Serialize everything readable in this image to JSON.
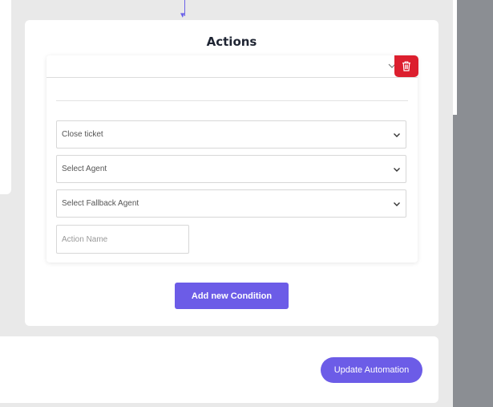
{
  "actions": {
    "title": "Actions",
    "fields": {
      "action_type": {
        "value": "Close ticket"
      },
      "agent": {
        "placeholder": "Select Agent"
      },
      "fallback_agent": {
        "placeholder": "Select Fallback Agent"
      },
      "action_name": {
        "placeholder": "Action Name"
      }
    },
    "add_condition_label": "Add new Condition"
  },
  "footer": {
    "update_label": "Update Automation"
  },
  "icons": {
    "delete": "trash-icon",
    "dropdown": "chevron-down-icon",
    "connector": "arrow-down-icon"
  },
  "colors": {
    "primary": "#6c5ce7",
    "danger": "#dc1f2e",
    "connector": "#6c63e8",
    "background": "#e9e9e9",
    "sidebar": "#8b8e93"
  }
}
